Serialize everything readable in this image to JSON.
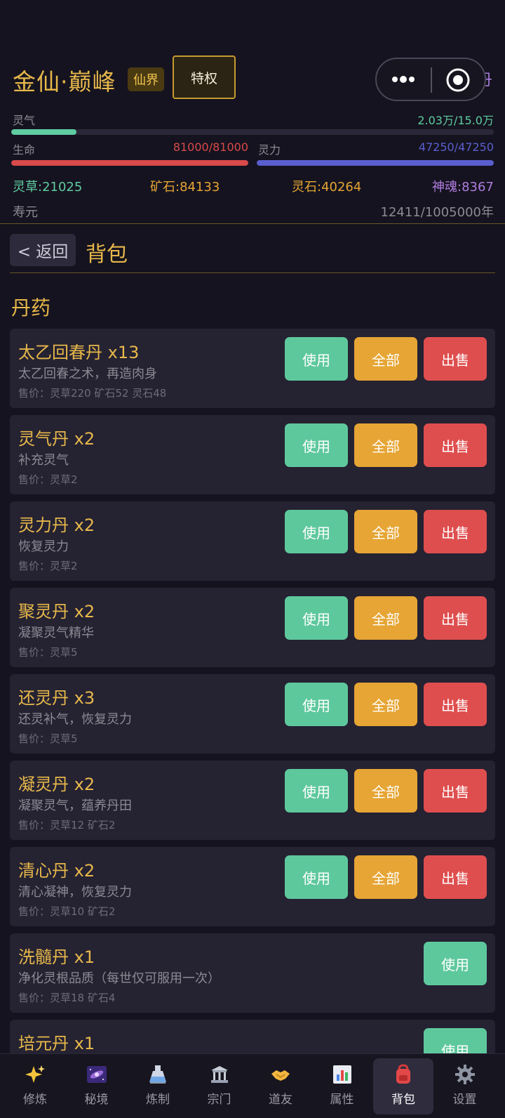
{
  "header": {
    "realm_title": "金仙·巅峰",
    "realm_badge": "仙界",
    "privilege_label": "特权",
    "alchemy_link": "炼丹",
    "qi": {
      "label": "灵气",
      "value": "2.03万/15.0万",
      "progress": 0.135,
      "color": "#5fcca1"
    },
    "life": {
      "label": "生命",
      "value": "81000/81000",
      "progress": 1.0,
      "color": "#d94a4a"
    },
    "spirit": {
      "label": "灵力",
      "value": "47250/47250",
      "progress": 1.0,
      "color": "#5a5fcf"
    },
    "resources": [
      {
        "text": "灵草:21025",
        "color": "#5fcca1"
      },
      {
        "text": "矿石:84133",
        "color": "#e6a534"
      },
      {
        "text": "灵石:40264",
        "color": "#e6a534"
      },
      {
        "text": "神魂:8367",
        "color": "#b07de0"
      }
    ],
    "lifespan": {
      "label": "寿元",
      "value": "12411/1005000年"
    }
  },
  "nav": {
    "back_label": "< 返回",
    "page_title": "背包"
  },
  "section_title": "丹药",
  "button_labels": {
    "use": "使用",
    "all": "全部",
    "sell": "出售"
  },
  "items": [
    {
      "name": "太乙回春丹 x13",
      "desc": "太乙回春之术，再造肉身",
      "price": "售价：灵草220 矿石52 灵石48",
      "full_actions": true
    },
    {
      "name": "灵气丹 x2",
      "desc": "补充灵气",
      "price": "售价：灵草2",
      "full_actions": true
    },
    {
      "name": "灵力丹 x2",
      "desc": "恢复灵力",
      "price": "售价：灵草2",
      "full_actions": true
    },
    {
      "name": "聚灵丹 x2",
      "desc": "凝聚灵气精华",
      "price": "售价：灵草5",
      "full_actions": true
    },
    {
      "name": "还灵丹 x3",
      "desc": "还灵补气，恢复灵力",
      "price": "售价：灵草5",
      "full_actions": true
    },
    {
      "name": "凝灵丹 x2",
      "desc": "凝聚灵气，蕴养丹田",
      "price": "售价：灵草12 矿石2",
      "full_actions": true
    },
    {
      "name": "清心丹 x2",
      "desc": "清心凝神，恢复灵力",
      "price": "售价：灵草10 矿石2",
      "full_actions": true
    },
    {
      "name": "洗髓丹 x1",
      "desc": "净化灵根品质（每世仅可服用一次）",
      "price": "售价：灵草18 矿石4",
      "full_actions": false
    },
    {
      "name": "培元丹 x1",
      "desc": "",
      "price": "",
      "full_actions": false
    }
  ],
  "tabs": [
    {
      "label": "修炼",
      "icon": "sparkle-icon",
      "active": false
    },
    {
      "label": "秘境",
      "icon": "galaxy-icon",
      "active": false
    },
    {
      "label": "炼制",
      "icon": "flask-icon",
      "active": false
    },
    {
      "label": "宗门",
      "icon": "temple-icon",
      "active": false
    },
    {
      "label": "道友",
      "icon": "handshake-icon",
      "active": false
    },
    {
      "label": "属性",
      "icon": "bar-chart-icon",
      "active": false
    },
    {
      "label": "背包",
      "icon": "backpack-icon",
      "active": true
    },
    {
      "label": "设置",
      "icon": "gear-icon",
      "active": false
    }
  ]
}
